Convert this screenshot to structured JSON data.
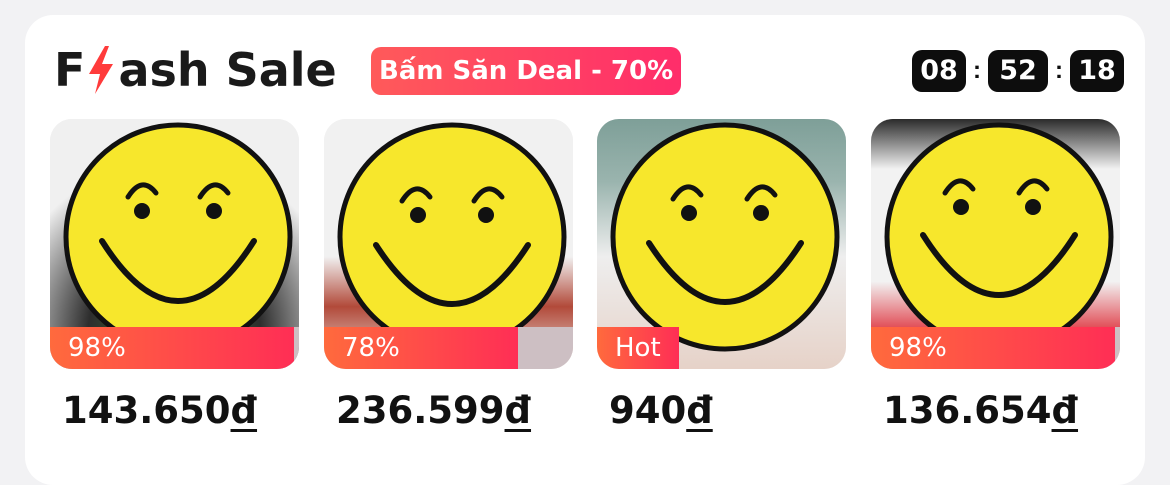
{
  "header": {
    "title_prefix": "F",
    "title_suffix": "ash Sale",
    "deal_badge": "Bấm Săn Deal - 70%",
    "countdown": {
      "hours": "08",
      "minutes": "52",
      "seconds": "18",
      "separator": ":"
    }
  },
  "colors": {
    "accent": "#ff2d55",
    "bolt": "#ff3b3b",
    "progress_empty": "#cdbfc3"
  },
  "products": [
    {
      "badge": "98%",
      "progress": 0.98,
      "price": "143.650",
      "currency": "đ"
    },
    {
      "badge": "78%",
      "progress": 0.78,
      "price": "236.599",
      "currency": "đ"
    },
    {
      "badge": "Hot",
      "progress": 0.33,
      "price": "940",
      "currency": "đ"
    },
    {
      "badge": "98%",
      "progress": 0.98,
      "price": "136.654",
      "currency": "đ"
    }
  ]
}
